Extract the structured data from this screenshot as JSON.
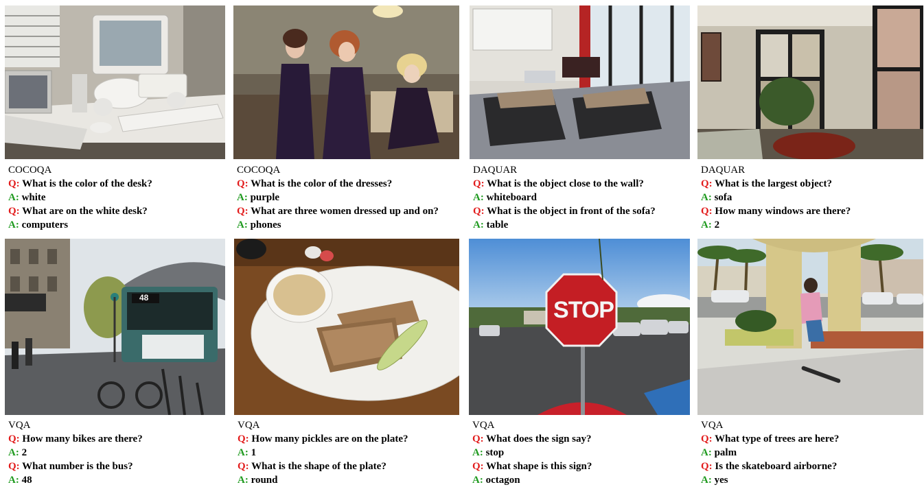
{
  "colors": {
    "question_marker": "#e21b1b",
    "answer_marker": "#1f9a1f"
  },
  "markers": {
    "q": "Q:",
    "a": "A:"
  },
  "panels": [
    {
      "dataset": "COCOQA",
      "qa": [
        {
          "q": "What is the color of the desk?",
          "a": "white"
        },
        {
          "q": "What are on the white desk?",
          "a": "computers"
        }
      ]
    },
    {
      "dataset": "COCOQA",
      "qa": [
        {
          "q": "What is the color of the dresses?",
          "a": "purple"
        },
        {
          "q": "What are three women dressed up and on?",
          "a": "phones"
        }
      ]
    },
    {
      "dataset": "DAQUAR",
      "qa": [
        {
          "q": "What is the object close to the wall?",
          "a": "whiteboard"
        },
        {
          "q": "What is the object in front of the sofa?",
          "a": "table"
        }
      ]
    },
    {
      "dataset": "DAQUAR",
      "qa": [
        {
          "q": "What is the largest object?",
          "a": "sofa"
        },
        {
          "q": "How many windows are there?",
          "a": "2"
        }
      ]
    },
    {
      "dataset": "VQA",
      "qa": [
        {
          "q": "How many bikes are there?",
          "a": "2"
        },
        {
          "q": "What number is the bus?",
          "a": "48"
        }
      ]
    },
    {
      "dataset": "VQA",
      "qa": [
        {
          "q": "How many pickles are on the plate?",
          "a": "1"
        },
        {
          "q": "What is the shape of the plate?",
          "a": "round"
        }
      ]
    },
    {
      "dataset": "VQA",
      "qa": [
        {
          "q": "What does the sign say?",
          "a": "stop"
        },
        {
          "q": "What shape is this sign?",
          "a": "octagon"
        }
      ]
    },
    {
      "dataset": "VQA",
      "qa": [
        {
          "q": "What type of trees are here?",
          "a": "palm"
        },
        {
          "q": "Is the skateboard airborne?",
          "a": "yes"
        }
      ]
    }
  ],
  "image_text": {
    "stop_sign": "STOP",
    "bus_number": "48"
  }
}
